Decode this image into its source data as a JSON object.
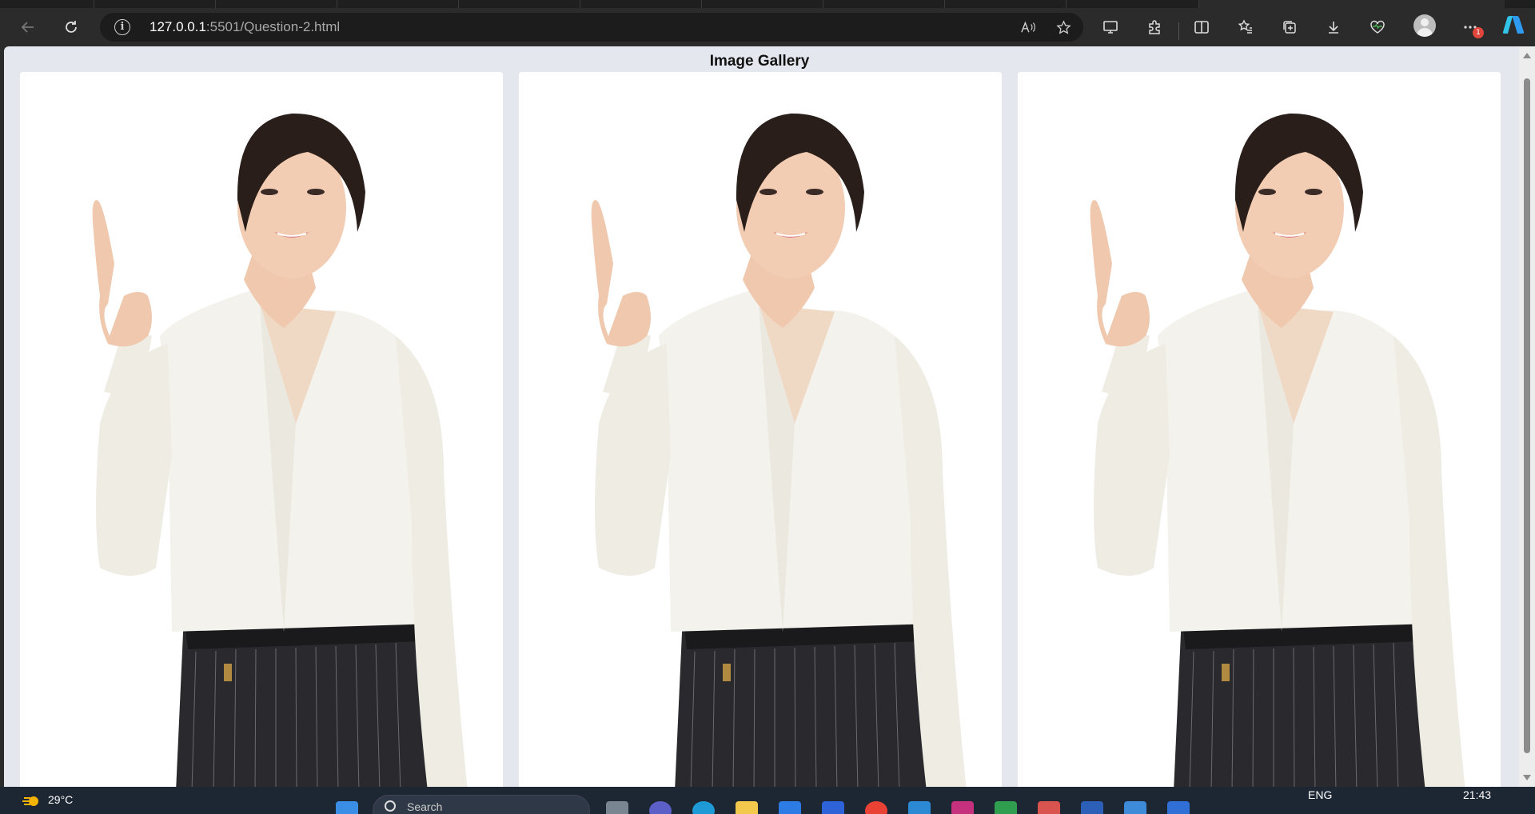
{
  "browser": {
    "url_host": "127.0.0.1",
    "url_path": ":5501/Question-2.html",
    "notification_count": "1"
  },
  "page": {
    "title": "Image Gallery",
    "cards": [
      {
        "alt": "woman-photo-1"
      },
      {
        "alt": "woman-photo-2"
      },
      {
        "alt": "woman-photo-3"
      }
    ]
  },
  "taskbar": {
    "temperature": "29°C",
    "search_placeholder": "Search",
    "language": "ENG",
    "time": "21:43"
  }
}
